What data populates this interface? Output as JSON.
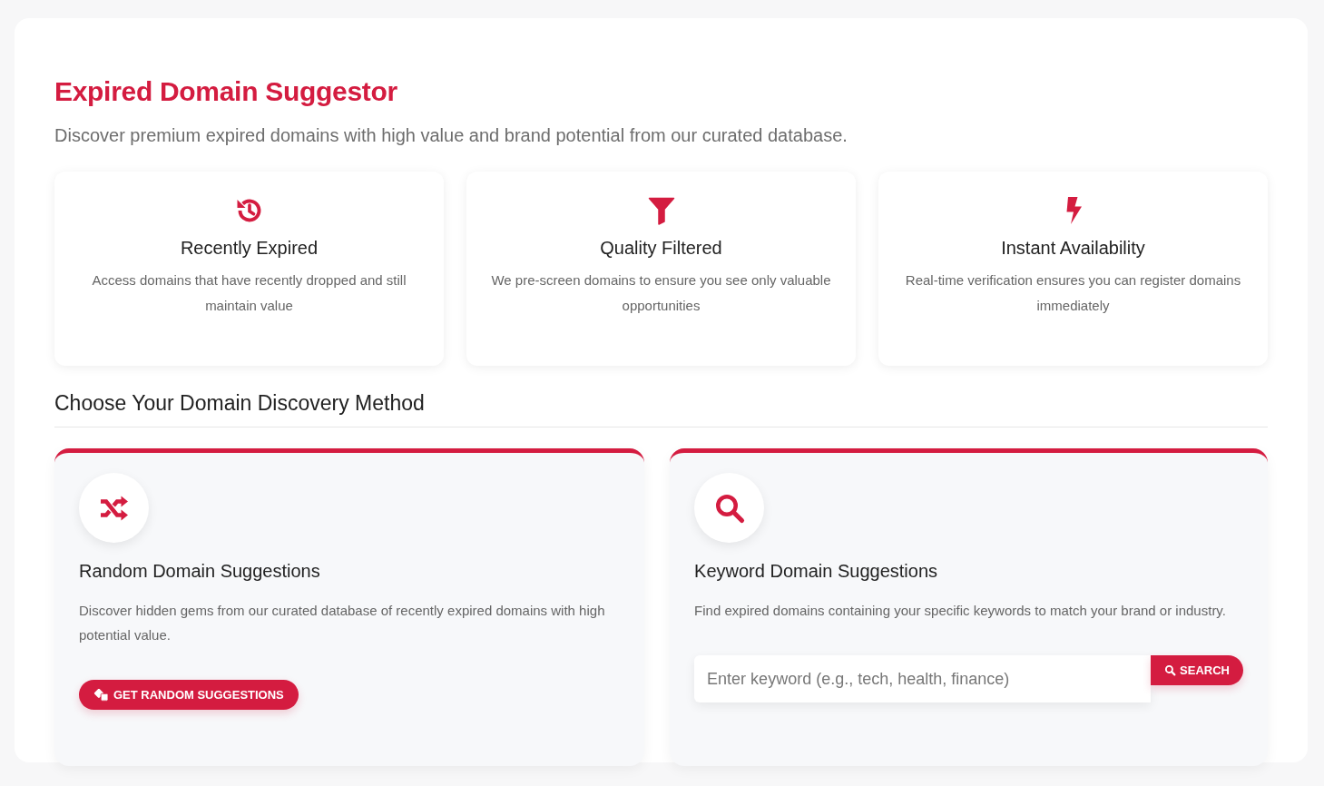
{
  "title": "Expired Domain Suggestor",
  "subtitle": "Discover premium expired domains with high value and brand potential from our curated database.",
  "features": [
    {
      "kind": "history",
      "title": "Recently Expired",
      "text": "Access domains that have recently dropped and still maintain value"
    },
    {
      "kind": "filter",
      "title": "Quality Filtered",
      "text": "We pre-screen domains to ensure you see only valuable opportunities"
    },
    {
      "kind": "bolt",
      "title": "Instant Availability",
      "text": "Real-time verification ensures you can register domains immediately"
    }
  ],
  "section_heading": "Choose Your Domain Discovery Method",
  "methods": [
    {
      "kind": "random",
      "title": "Random Domain Suggestions",
      "text": "Discover hidden gems from our curated database of recently expired domains with high potential value.",
      "button": "GET RANDOM SUGGESTIONS"
    },
    {
      "kind": "keyword",
      "title": "Keyword Domain Suggestions",
      "text": "Find expired domains containing your specific keywords to match your brand or industry.",
      "placeholder": "Enter keyword (e.g., tech, health, finance)",
      "button": "SEARCH"
    }
  ]
}
